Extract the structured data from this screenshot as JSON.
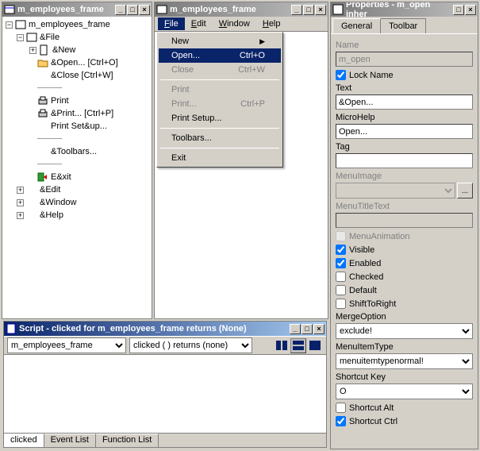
{
  "tree_panel": {
    "title": "m_employees_frame",
    "root": "m_employees_frame",
    "file": "&File",
    "items": {
      "new": "&New",
      "open": "&Open...  [Ctrl+O]",
      "close": "&Close  [Ctrl+W]",
      "print": "Print",
      "printdlg": "&Print...  [Ctrl+P]",
      "setup": "Print Set&up...",
      "toolbars": "&Toolbars...",
      "exit": "E&xit"
    },
    "edit": "&Edit",
    "window": "&Window",
    "help": "&Help"
  },
  "menu_panel": {
    "title": "m_employees_frame",
    "menubar": {
      "file": "File",
      "edit": "Edit",
      "window": "Window",
      "help": "Help"
    },
    "dropdown": {
      "new": "New",
      "open": "Open...",
      "open_sc": "Ctrl+O",
      "close": "Close",
      "close_sc": "Ctrl+W",
      "print": "Print",
      "printdlg": "Print...",
      "printdlg_sc": "Ctrl+P",
      "setup": "Print Setup...",
      "toolbars": "Toolbars...",
      "exit": "Exit"
    }
  },
  "props_panel": {
    "title": "Properties - m_open  inher",
    "tabs": {
      "general": "General",
      "toolbar": "Toolbar"
    },
    "labels": {
      "name": "Name",
      "lockname": "Lock Name",
      "text": "Text",
      "microhelp": "MicroHelp",
      "tag": "Tag",
      "menuimage": "MenuImage",
      "menutitletext": "MenuTitleText",
      "menuanimation": "MenuAnimation",
      "visible": "Visible",
      "enabled": "Enabled",
      "checked": "Checked",
      "default": "Default",
      "shifttoright": "ShiftToRight",
      "mergeoption": "MergeOption",
      "menuitemtype": "MenuItemType",
      "shortcutkey": "Shortcut Key",
      "shortcutalt": "Shortcut Alt",
      "shortcutctrl": "Shortcut Ctrl"
    },
    "values": {
      "name": "m_open",
      "text": "&Open...",
      "microhelp": "Open...",
      "tag": "",
      "mergeoption": "exclude!",
      "menuitemtype": "menuitemtypenormal!",
      "shortcutkey": "O",
      "browse": "..."
    }
  },
  "script_panel": {
    "title": "Script - clicked for m_employees_frame returns (None)",
    "sel1": "m_employees_frame",
    "sel2": "clicked ( ) returns (none)"
  },
  "bottom_tabs": {
    "clicked": "clicked",
    "eventlist": "Event List",
    "functionlist": "Function List"
  }
}
